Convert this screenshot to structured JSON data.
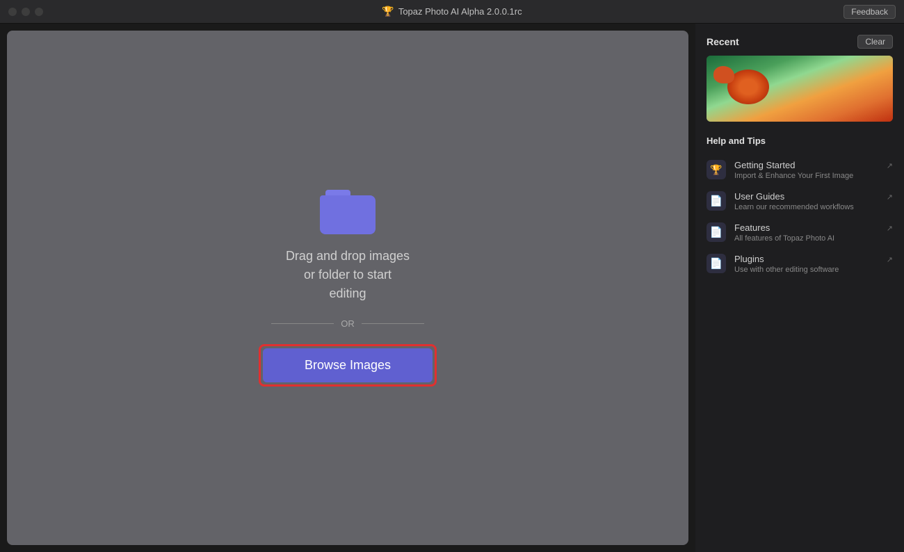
{
  "titlebar": {
    "title": "Topaz Photo AI Alpha 2.0.0.1rc",
    "feedback_label": "Feedback",
    "traffic_lights": [
      "close",
      "minimize",
      "maximize"
    ]
  },
  "drop_zone": {
    "drag_text": "Drag and drop images\nor folder to start\nediting",
    "or_label": "OR",
    "browse_button_label": "Browse Images"
  },
  "sidebar": {
    "recent_title": "Recent",
    "clear_label": "Clear",
    "help_tips_title": "Help and Tips",
    "help_items": [
      {
        "title": "Getting Started",
        "desc": "Import & Enhance Your First Image",
        "icon_type": "topaz"
      },
      {
        "title": "User Guides",
        "desc": "Learn our recommended workflows",
        "icon_type": "doc"
      },
      {
        "title": "Features",
        "desc": "All features of Topaz Photo AI",
        "icon_type": "doc"
      },
      {
        "title": "Plugins",
        "desc": "Use with other editing software",
        "icon_type": "doc"
      }
    ]
  }
}
